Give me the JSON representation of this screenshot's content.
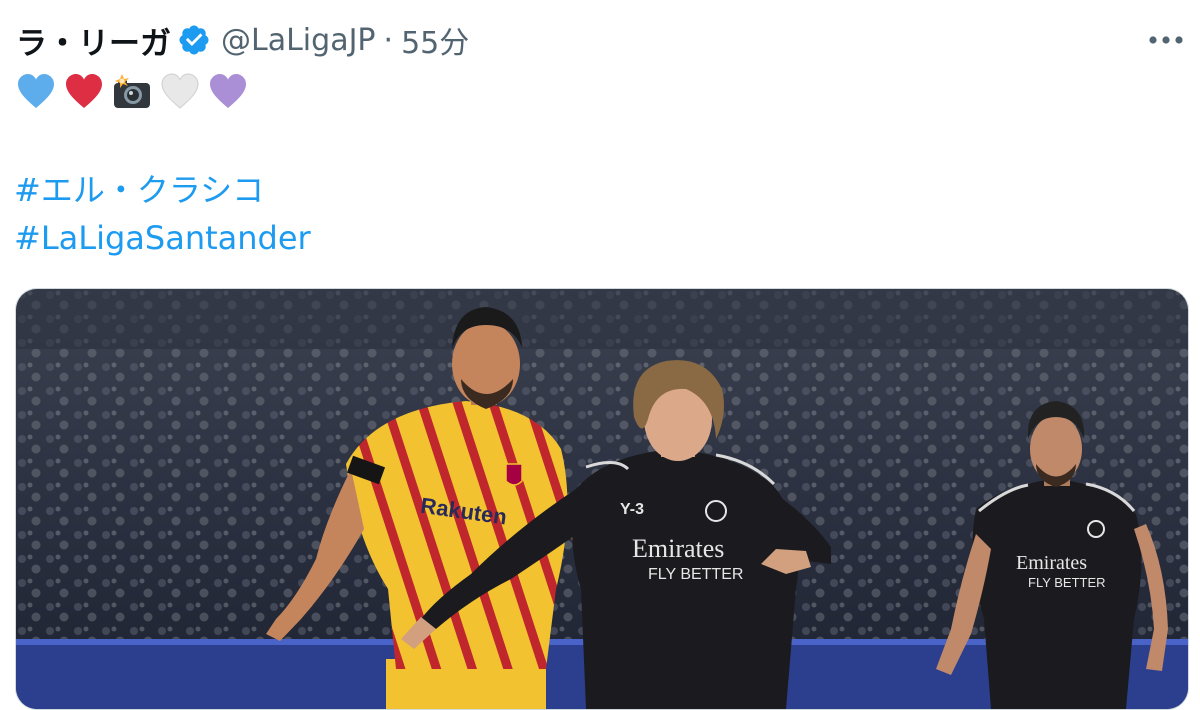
{
  "tweet": {
    "display_name": "ラ・リーガ",
    "handle": "@LaLigaJP",
    "separator": "·",
    "timestamp": "55分",
    "more_icon": "more-horizontal-icon",
    "verified_icon": "verified-badge-icon",
    "emojis": [
      "blue-heart-icon",
      "red-heart-icon",
      "camera-flash-icon",
      "white-heart-icon",
      "purple-heart-icon"
    ],
    "hashtags": [
      "#エル・クラシコ",
      "#LaLigaSantander"
    ]
  },
  "media": {
    "jersey_sponsor_left": "Rakuten",
    "jersey_sponsor_center": "Emirates",
    "jersey_tagline_center": "FLY BETTER",
    "jersey_brand_center": "Y-3",
    "jersey_sponsor_right": "Emirates",
    "jersey_tagline_right": "FLY BETTER"
  },
  "colors": {
    "link": "#1d9bf0",
    "secondary_text": "#536471",
    "barca_yellow": "#f2c230",
    "barca_red": "#c0272d",
    "madrid_black": "#1b1b1f"
  }
}
